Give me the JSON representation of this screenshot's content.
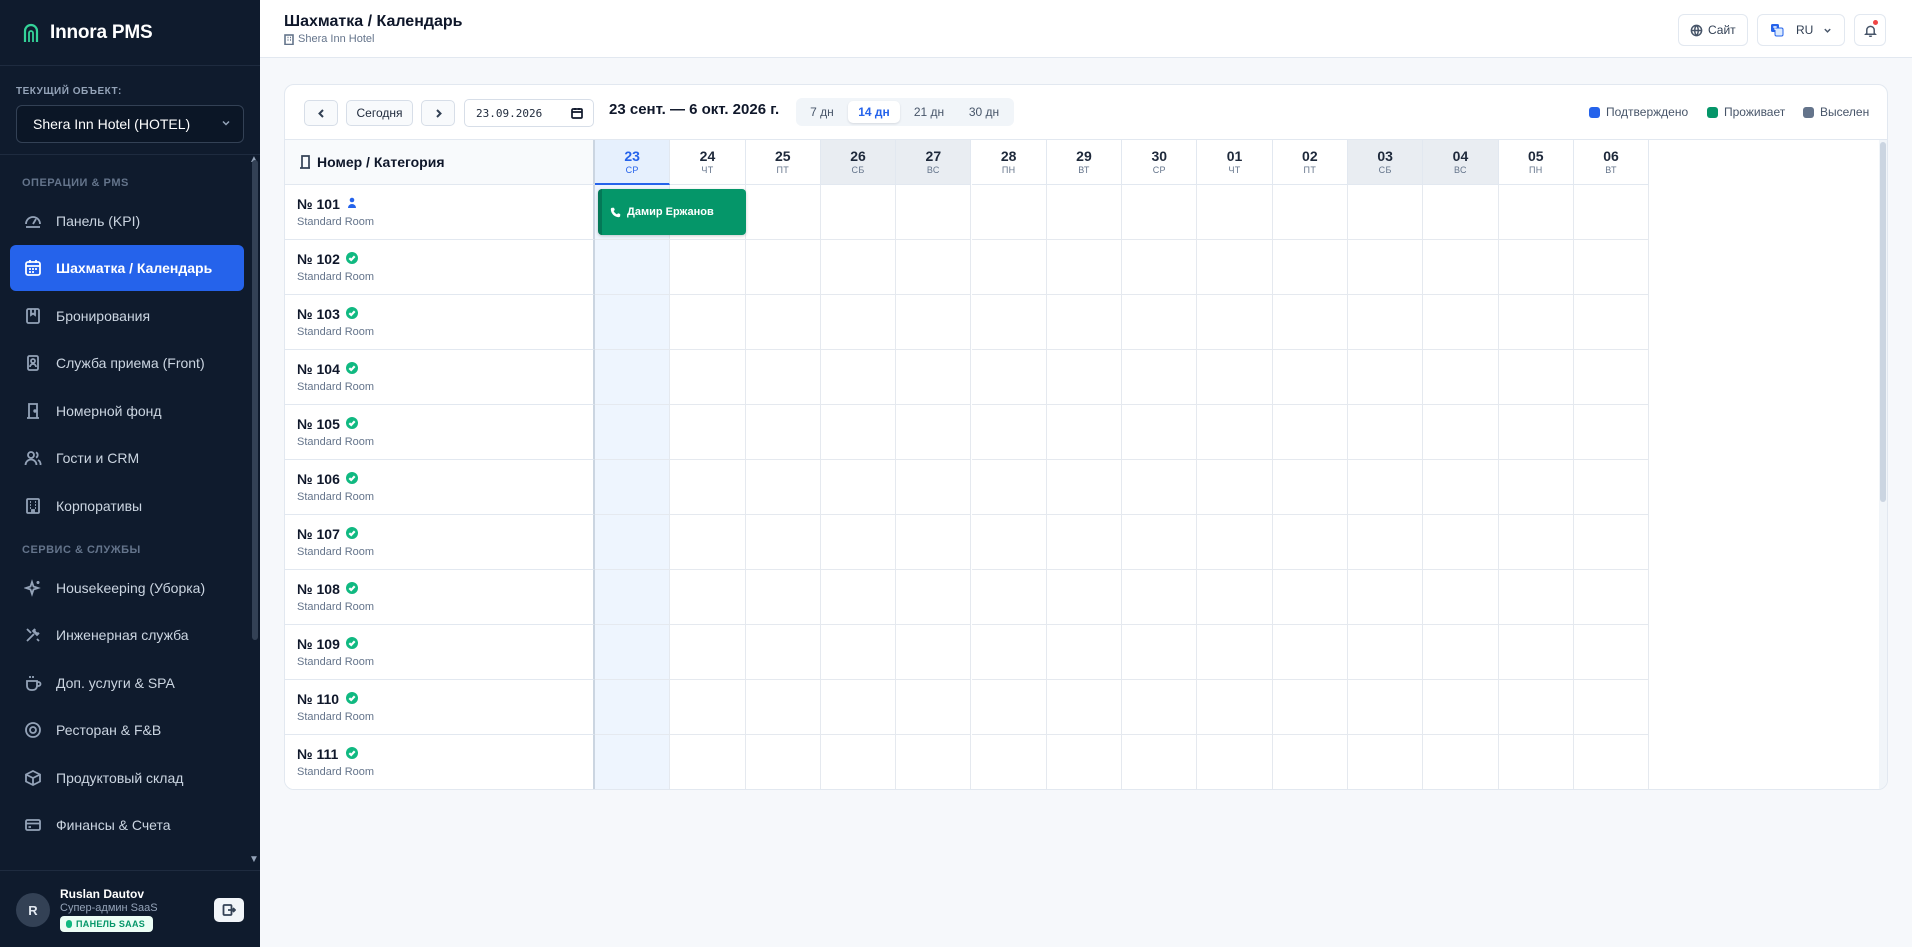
{
  "app": {
    "name": "Innora PMS",
    "accent": "#2563eb",
    "sidebar_bg": "#0f1b2d"
  },
  "property": {
    "label": "ТЕКУЩИЙ ОБЪЕКТ:",
    "selected": "Shera Inn Hotel (HOTEL)"
  },
  "nav": {
    "section_ops": "ОПЕРАЦИИ & PMS",
    "section_service": "СЕРВИС & СЛУЖБЫ",
    "items": [
      {
        "label": "Панель (KPI)",
        "icon": "dashboard-icon"
      },
      {
        "label": "Шахматка / Календарь",
        "icon": "calendar-icon",
        "active": true
      },
      {
        "label": "Бронирования",
        "icon": "booking-icon"
      },
      {
        "label": "Служба приема (Front)",
        "icon": "front-desk-icon"
      },
      {
        "label": "Номерной фонд",
        "icon": "room-door-icon"
      },
      {
        "label": "Гости и CRM",
        "icon": "users-icon"
      },
      {
        "label": "Корпоративы",
        "icon": "building-icon"
      },
      {
        "label": "Housekeeping (Уборка)",
        "icon": "sparkles-icon"
      },
      {
        "label": "Инженерная служба",
        "icon": "tools-icon"
      },
      {
        "label": "Доп. услуги & SPA",
        "icon": "coffee-icon"
      },
      {
        "label": "Ресторан & F&B",
        "icon": "restaurant-icon"
      },
      {
        "label": "Продуктовый склад",
        "icon": "box-icon"
      },
      {
        "label": "Финансы & Счета",
        "icon": "credit-card-icon"
      }
    ]
  },
  "user": {
    "initial": "R",
    "name": "Ruslan Dautov",
    "role": "Супер-админ SaaS",
    "badge": "ПАНЕЛЬ SAAS"
  },
  "header": {
    "title": "Шахматка / Календарь",
    "hotel": "Shera Inn Hotel",
    "site_label": "Сайт",
    "lang": "RU"
  },
  "toolbar": {
    "today_label": "Сегодня",
    "date_value": "23.09.2026",
    "range_title": "23 сент. — 6 окт. 2026 г.",
    "views": [
      {
        "label": "7 дн"
      },
      {
        "label": "14 дн",
        "active": true
      },
      {
        "label": "21 дн"
      },
      {
        "label": "30 дн"
      }
    ],
    "legend": [
      {
        "label": "Подтверждено",
        "color": "#2563eb"
      },
      {
        "label": "Проживает",
        "color": "#059669"
      },
      {
        "label": "Выселен",
        "color": "#64748b"
      }
    ]
  },
  "calendar": {
    "corner_label": "Номер / Категория",
    "days": [
      {
        "day": "23",
        "dow": "СР",
        "today": true
      },
      {
        "day": "24",
        "dow": "ЧТ"
      },
      {
        "day": "25",
        "dow": "ПТ"
      },
      {
        "day": "26",
        "dow": "СБ",
        "weekend": true
      },
      {
        "day": "27",
        "dow": "ВС",
        "weekend": true
      },
      {
        "day": "28",
        "dow": "ПН"
      },
      {
        "day": "29",
        "dow": "ВТ"
      },
      {
        "day": "30",
        "dow": "СР"
      },
      {
        "day": "01",
        "dow": "ЧТ"
      },
      {
        "day": "02",
        "dow": "ПТ"
      },
      {
        "day": "03",
        "dow": "СБ",
        "weekend": true
      },
      {
        "day": "04",
        "dow": "ВС",
        "weekend": true
      },
      {
        "day": "05",
        "dow": "ПН"
      },
      {
        "day": "06",
        "dow": "ВТ"
      }
    ],
    "rooms": [
      {
        "number": "№ 101",
        "category": "Standard Room",
        "status": "occupied"
      },
      {
        "number": "№ 102",
        "category": "Standard Room",
        "status": "clean"
      },
      {
        "number": "№ 103",
        "category": "Standard Room",
        "status": "clean"
      },
      {
        "number": "№ 104",
        "category": "Standard Room",
        "status": "clean"
      },
      {
        "number": "№ 105",
        "category": "Standard Room",
        "status": "clean"
      },
      {
        "number": "№ 106",
        "category": "Standard Room",
        "status": "clean"
      },
      {
        "number": "№ 107",
        "category": "Standard Room",
        "status": "clean"
      },
      {
        "number": "№ 108",
        "category": "Standard Room",
        "status": "clean"
      },
      {
        "number": "№ 109",
        "category": "Standard Room",
        "status": "clean"
      },
      {
        "number": "№ 110",
        "category": "Standard Room",
        "status": "clean"
      },
      {
        "number": "№ 111",
        "category": "Standard Room",
        "status": "clean"
      }
    ],
    "booking": {
      "guest": "Дамир Ержанов",
      "room": "№ 101",
      "start": "23",
      "nights": 2,
      "status": "Проживает",
      "color": "#059669"
    }
  }
}
